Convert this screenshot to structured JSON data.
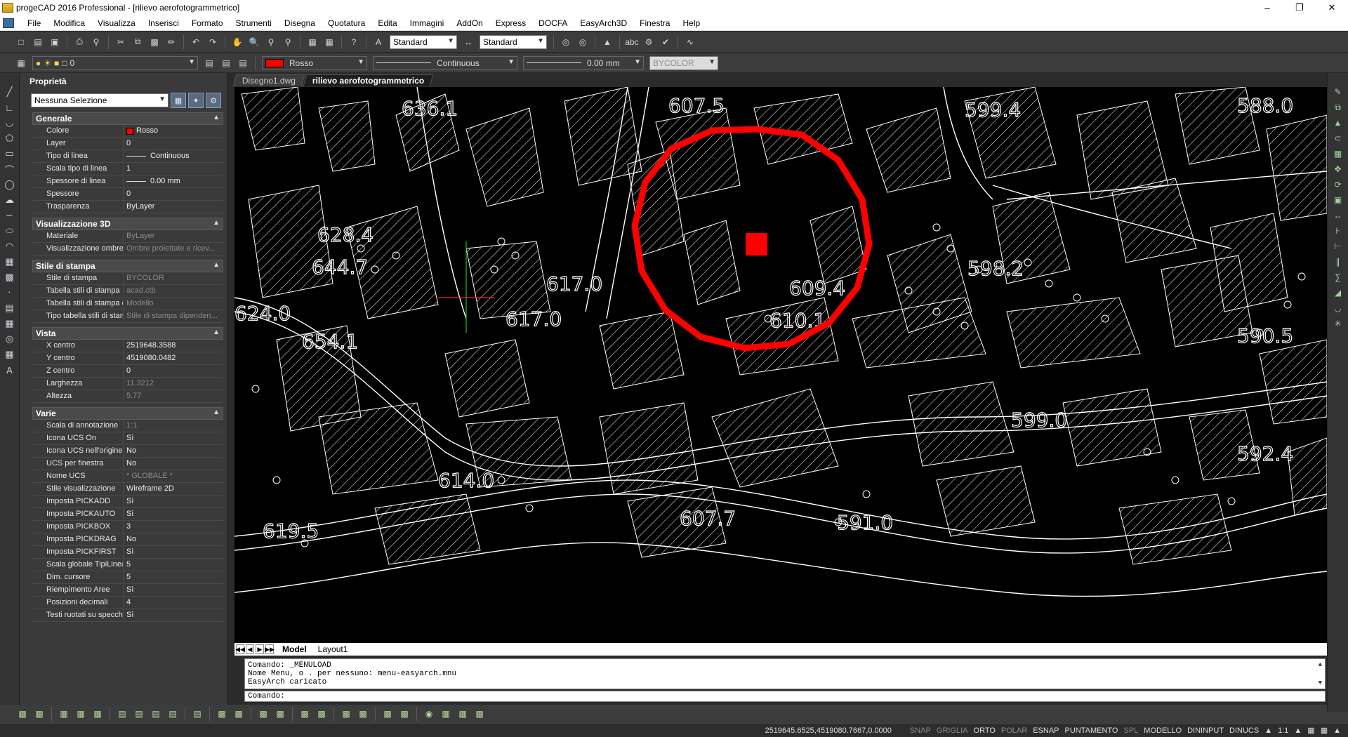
{
  "title": "progeCAD 2016 Professional - [rilievo aerofotogrammetrico]",
  "menu": [
    "File",
    "Modifica",
    "Visualizza",
    "Inserisci",
    "Formato",
    "Strumenti",
    "Disegna",
    "Quotatura",
    "Edita",
    "Immagini",
    "AddOn",
    "Express",
    "DOCFA",
    "EasyArch3D",
    "Finestra",
    "Help"
  ],
  "toolbar1": {
    "textstyle": "Standard",
    "dimstyle": "Standard"
  },
  "toolbar2": {
    "layer": "0",
    "color": "Rosso",
    "linetype": "Continuous",
    "lineweight": "0.00 mm",
    "plotstyle": "BYCOLOR"
  },
  "props": {
    "title": "Proprietà",
    "selection": "Nessuna Selezione",
    "sections": {
      "generale": {
        "title": "Generale",
        "rows": [
          {
            "k": "Colore",
            "v": "Rosso"
          },
          {
            "k": "Layer",
            "v": "0"
          },
          {
            "k": "Tipo di linea",
            "v": "Continuous"
          },
          {
            "k": "Scala tipo di linea",
            "v": "1"
          },
          {
            "k": "Spessore di linea",
            "v": "0.00 mm"
          },
          {
            "k": "Spessore",
            "v": "0"
          },
          {
            "k": "Trasparenza",
            "v": "ByLayer"
          }
        ]
      },
      "vis3d": {
        "title": "Visualizzazione 3D",
        "rows": [
          {
            "k": "Materiale",
            "v": "ByLayer"
          },
          {
            "k": "Visualizzazione ombre",
            "v": "Ombre proiettate e ricev..."
          }
        ]
      },
      "stile": {
        "title": "Stile di stampa",
        "rows": [
          {
            "k": "Stile di stampa",
            "v": "BYCOLOR"
          },
          {
            "k": "Tabella stili di stampa",
            "v": "acad.ctb"
          },
          {
            "k": "Tabella stili di stampa c...",
            "v": "Modello"
          },
          {
            "k": "Tipo tabella stili di stampa",
            "v": "Stile di stampa dipenden..."
          }
        ]
      },
      "vista": {
        "title": "Vista",
        "rows": [
          {
            "k": "X centro",
            "v": "2519648.3588"
          },
          {
            "k": "Y centro",
            "v": "4519080.0482"
          },
          {
            "k": "Z centro",
            "v": "0"
          },
          {
            "k": "Larghezza",
            "v": "11.3212"
          },
          {
            "k": "Altezza",
            "v": "5.77"
          }
        ]
      },
      "varie": {
        "title": "Varie",
        "rows": [
          {
            "k": "Scala di annotazione",
            "v": "1:1"
          },
          {
            "k": "Icona UCS On",
            "v": "Sì"
          },
          {
            "k": "Icona UCS nell'origine",
            "v": "No"
          },
          {
            "k": "UCS per finestra",
            "v": "No"
          },
          {
            "k": "Nome UCS",
            "v": "* GLOBALE *"
          },
          {
            "k": "Stile visualizzazione",
            "v": "Wireframe 2D"
          },
          {
            "k": "Imposta PICKADD",
            "v": "Sì"
          },
          {
            "k": "Imposta PICKAUTO",
            "v": "Sì"
          },
          {
            "k": "Imposta PICKBOX",
            "v": "3"
          },
          {
            "k": "Imposta PICKDRAG",
            "v": "No"
          },
          {
            "k": "Imposta PICKFIRST",
            "v": "Sì"
          },
          {
            "k": "Scala globale TipiLinea",
            "v": "5"
          },
          {
            "k": "Dim. cursore",
            "v": "5"
          },
          {
            "k": "Riempimento Aree",
            "v": "Sì"
          },
          {
            "k": "Posizioni decimali",
            "v": "4"
          },
          {
            "k": "Testi ruotati su specchio",
            "v": "Sì"
          }
        ]
      }
    }
  },
  "tabs": [
    "Disegno1.dwg",
    "rilievo aerofotogrammetrico"
  ],
  "elevations": [
    "636.1",
    "607.5",
    "599.4",
    "588.0",
    "628.4",
    "644.7",
    "598.2",
    "617.0",
    "609.4",
    "624.0",
    "617.0",
    "610.1",
    "590.5",
    "654.1",
    "599.0",
    "592.4",
    "614.0",
    "619.5",
    "607.7",
    "591.0"
  ],
  "layout_tabs": [
    "Model",
    "Layout1"
  ],
  "command_history": [
    "Comando: _MENULOAD",
    "Nome Menu, o . per nessuno: menu-easyarch.mnu",
    "EasyArch caricato"
  ],
  "command_prompt": "Comando:",
  "status": {
    "coords": "2519645.6525,4519080.7667,0.0000",
    "toggles": [
      {
        "label": "SNAP",
        "on": false
      },
      {
        "label": "GRIGLIA",
        "on": false
      },
      {
        "label": "ORTO",
        "on": true
      },
      {
        "label": "POLAR",
        "on": false
      },
      {
        "label": "ESNAP",
        "on": true
      },
      {
        "label": "PUNTAMENTO",
        "on": true
      },
      {
        "label": "SPL",
        "on": false
      },
      {
        "label": "MODELLO",
        "on": true
      },
      {
        "label": "DININPUT",
        "on": true
      },
      {
        "label": "DINUCS",
        "on": true
      }
    ],
    "scale": "1:1"
  },
  "colors": {
    "accent_red": "#ff0000",
    "canvas": "#000000",
    "panel": "#3a3a3a"
  }
}
